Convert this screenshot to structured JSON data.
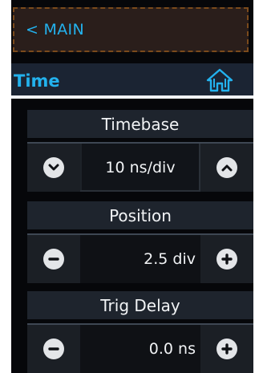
{
  "nav": {
    "back_label": "< MAIN"
  },
  "section": {
    "title": "Time",
    "home_icon": "home-icon"
  },
  "controls": [
    {
      "label": "Timebase",
      "value": "10 ns/div",
      "left_icon": "chevron-down-icon",
      "right_icon": "chevron-up-icon"
    },
    {
      "label": "Position",
      "value": "2.5 div",
      "left_icon": "minus-icon",
      "right_icon": "plus-icon"
    },
    {
      "label": "Trig Delay",
      "value": "0.0 ns",
      "left_icon": "minus-icon",
      "right_icon": "plus-icon"
    }
  ],
  "colors": {
    "accent": "#23b2ee",
    "background": "#06070a",
    "text": "#f1f3f5",
    "button_fill": "#e3e5e8"
  }
}
